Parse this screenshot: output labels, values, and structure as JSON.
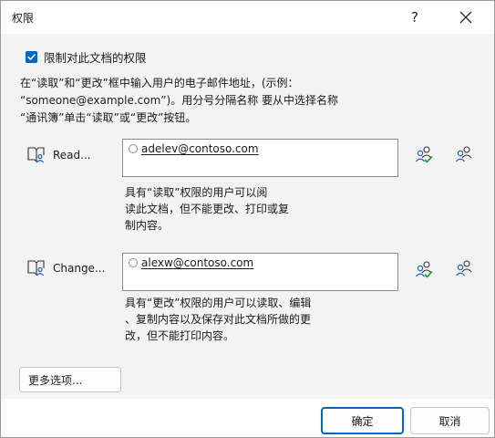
{
  "dialog": {
    "title": "权限",
    "help_label": "?",
    "restrict_checkbox": {
      "label": "限制对此文档的权限",
      "checked": true
    },
    "instructions": [
      "在“读取”和“更改”框中输入用户的电子邮件地址，(示例：",
      "“someone@example.com”)。用分号分隔名称 要从中选择名称",
      "“通讯簿”单击“读取”或“更改”按钮。"
    ],
    "read": {
      "button_label": "Read...",
      "email": "adelev@contoso.com",
      "description": [
        "具有“读取”权限的用户可以阅",
        "读此文档，但不能更改、打印或复",
        "制内容。"
      ]
    },
    "change": {
      "button_label": "Change...",
      "email": "alexw@contoso.com",
      "description": [
        "具有“更改”权限的用户可以读取、编辑",
        "、复制内容以及保存对此文档所做的更",
        "改，但不能打印内容。"
      ]
    },
    "more_options_label": "更多选项...",
    "ok_label": "确定",
    "cancel_label": "取消"
  },
  "colors": {
    "accent": "#0067c0",
    "panel_bg": "#f3f3f3",
    "icon_blue": "#1f5fbf",
    "check_green": "#13a10e"
  }
}
